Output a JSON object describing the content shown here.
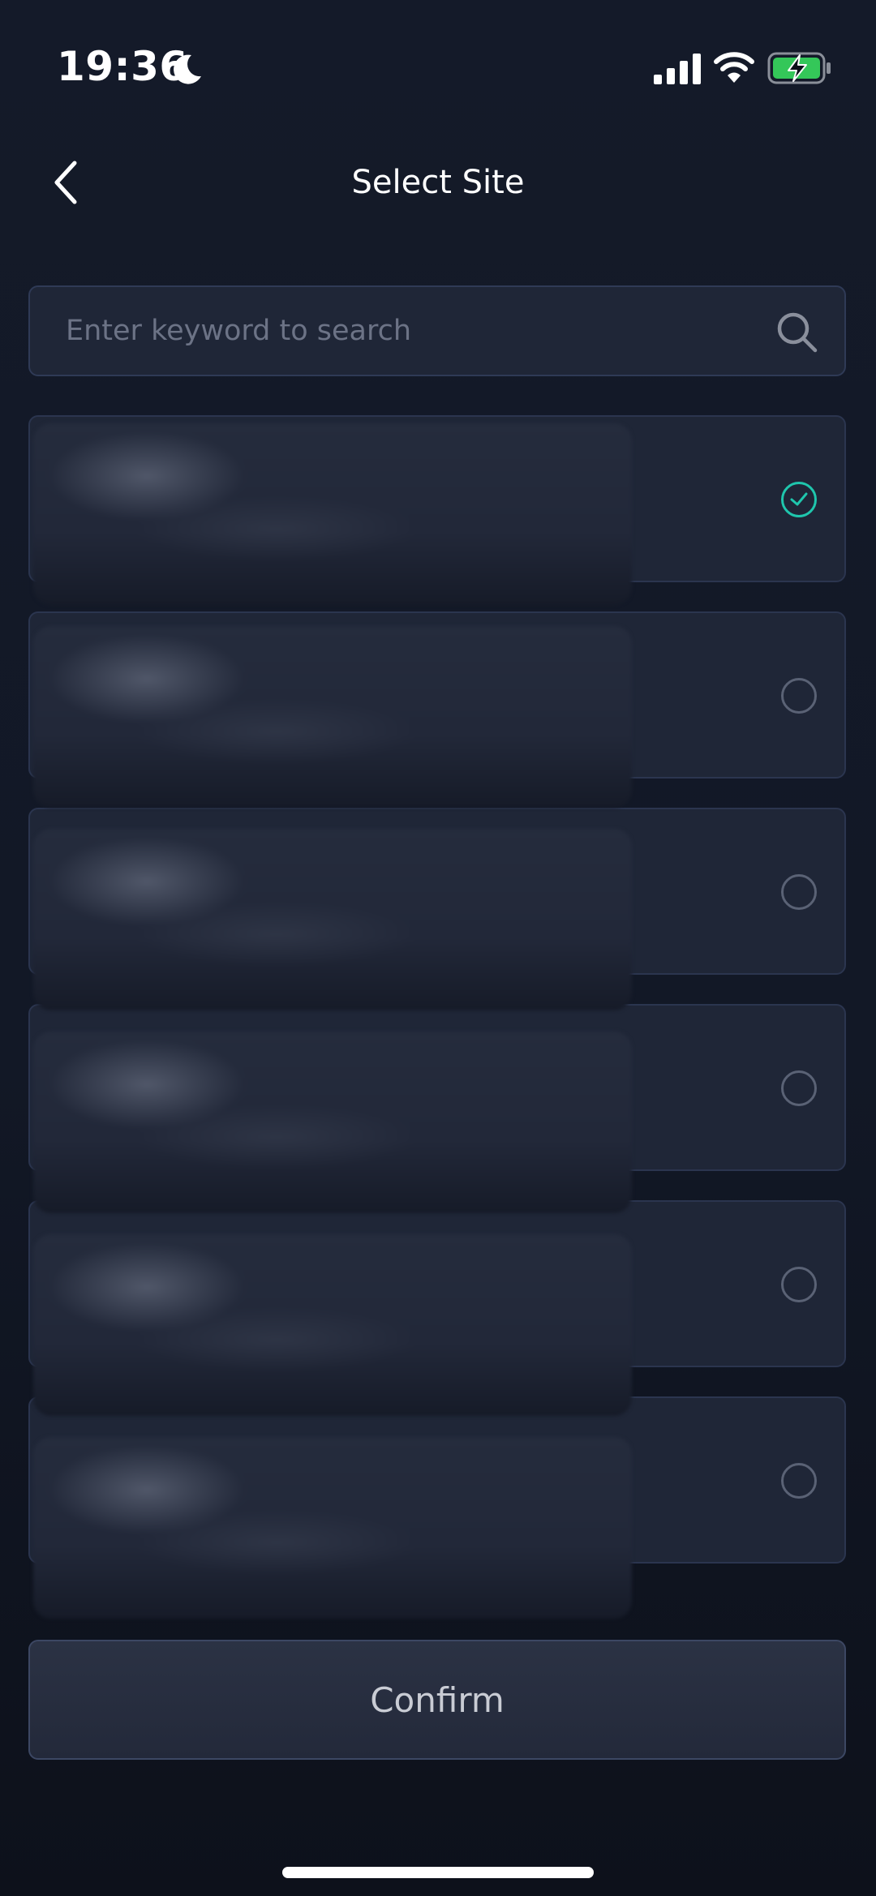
{
  "status_bar": {
    "time": "19:36",
    "icons": [
      "moon-icon",
      "signal-icon",
      "wifi-icon",
      "battery-charging-icon"
    ],
    "battery_color": "#34c759"
  },
  "header": {
    "title": "Select Site",
    "back_icon": "chevron-left-icon"
  },
  "search": {
    "placeholder": "Enter keyword to search",
    "value": "",
    "icon": "search-icon"
  },
  "sites": {
    "items": [
      {
        "selected": true
      },
      {
        "selected": false
      },
      {
        "selected": false
      },
      {
        "selected": false
      },
      {
        "selected": false
      },
      {
        "selected": false
      }
    ]
  },
  "footer": {
    "confirm_label": "Confirm"
  },
  "colors": {
    "background": "#121826",
    "card": "#1f2637",
    "accent": "#1fc6ad"
  }
}
